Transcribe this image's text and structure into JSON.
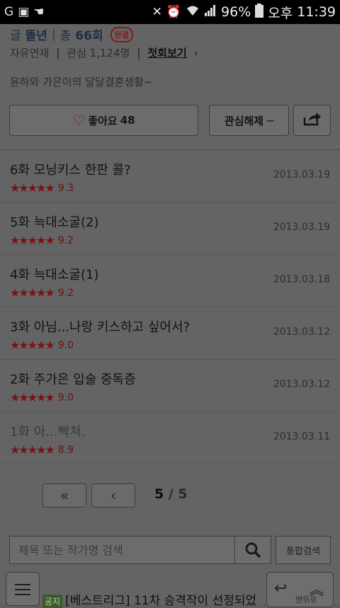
{
  "status_bar": {
    "battery": "96%",
    "ampm": "오후",
    "time": "11:39",
    "icons": [
      "g-notification-icon",
      "image-icon",
      "hand-icon",
      "mute-icon",
      "alarm-icon",
      "wifi-icon",
      "signal-icon",
      "battery-icon"
    ]
  },
  "header": {
    "author_prefix": "글",
    "author": "똘년",
    "total_label": "총",
    "total_count": "66회",
    "status_badge": "완결",
    "genre": "자유연재",
    "interest_label": "관심",
    "interest_count": "1,124명",
    "first_view": "첫회보기",
    "chevron": "›"
  },
  "description": "윤하와 가은이의 달달결혼생활~",
  "actions": {
    "like_label": "좋아요",
    "like_count": "48",
    "unfollow_label": "관심해제 ─"
  },
  "episodes": [
    {
      "title": "6화 모닝키스 한판 콜?",
      "score": "9.3",
      "date": "2013.03.19"
    },
    {
      "title": "5화 늑대소굴(2)",
      "score": "9.2",
      "date": "2013.03.19"
    },
    {
      "title": "4화 늑대소굴(1)",
      "score": "9.2",
      "date": "2013.03.18"
    },
    {
      "title": "3화 아님...나랑 키스하고 싶어서?",
      "score": "9.0",
      "date": "2013.03.12"
    },
    {
      "title": "2화 주가은 입술 중독증",
      "score": "9.0",
      "date": "2013.03.12"
    },
    {
      "title": "1화 아...빡쳐.",
      "score": "8.9",
      "date": "2013.03.11"
    }
  ],
  "pagination": {
    "first": "«",
    "prev": "‹",
    "current": "5",
    "separator": " / ",
    "total": "5"
  },
  "search": {
    "placeholder": "제목 또는 작가명 검색",
    "total_search": "통합검색"
  },
  "bottom": {
    "notice_tag": "공지",
    "notice_text": "[베스트리그] 11차 승격작이 선정되었",
    "top_label": "맨위로"
  },
  "colors": {
    "accent": "#7a1616",
    "overlay_bg": "#646464"
  }
}
